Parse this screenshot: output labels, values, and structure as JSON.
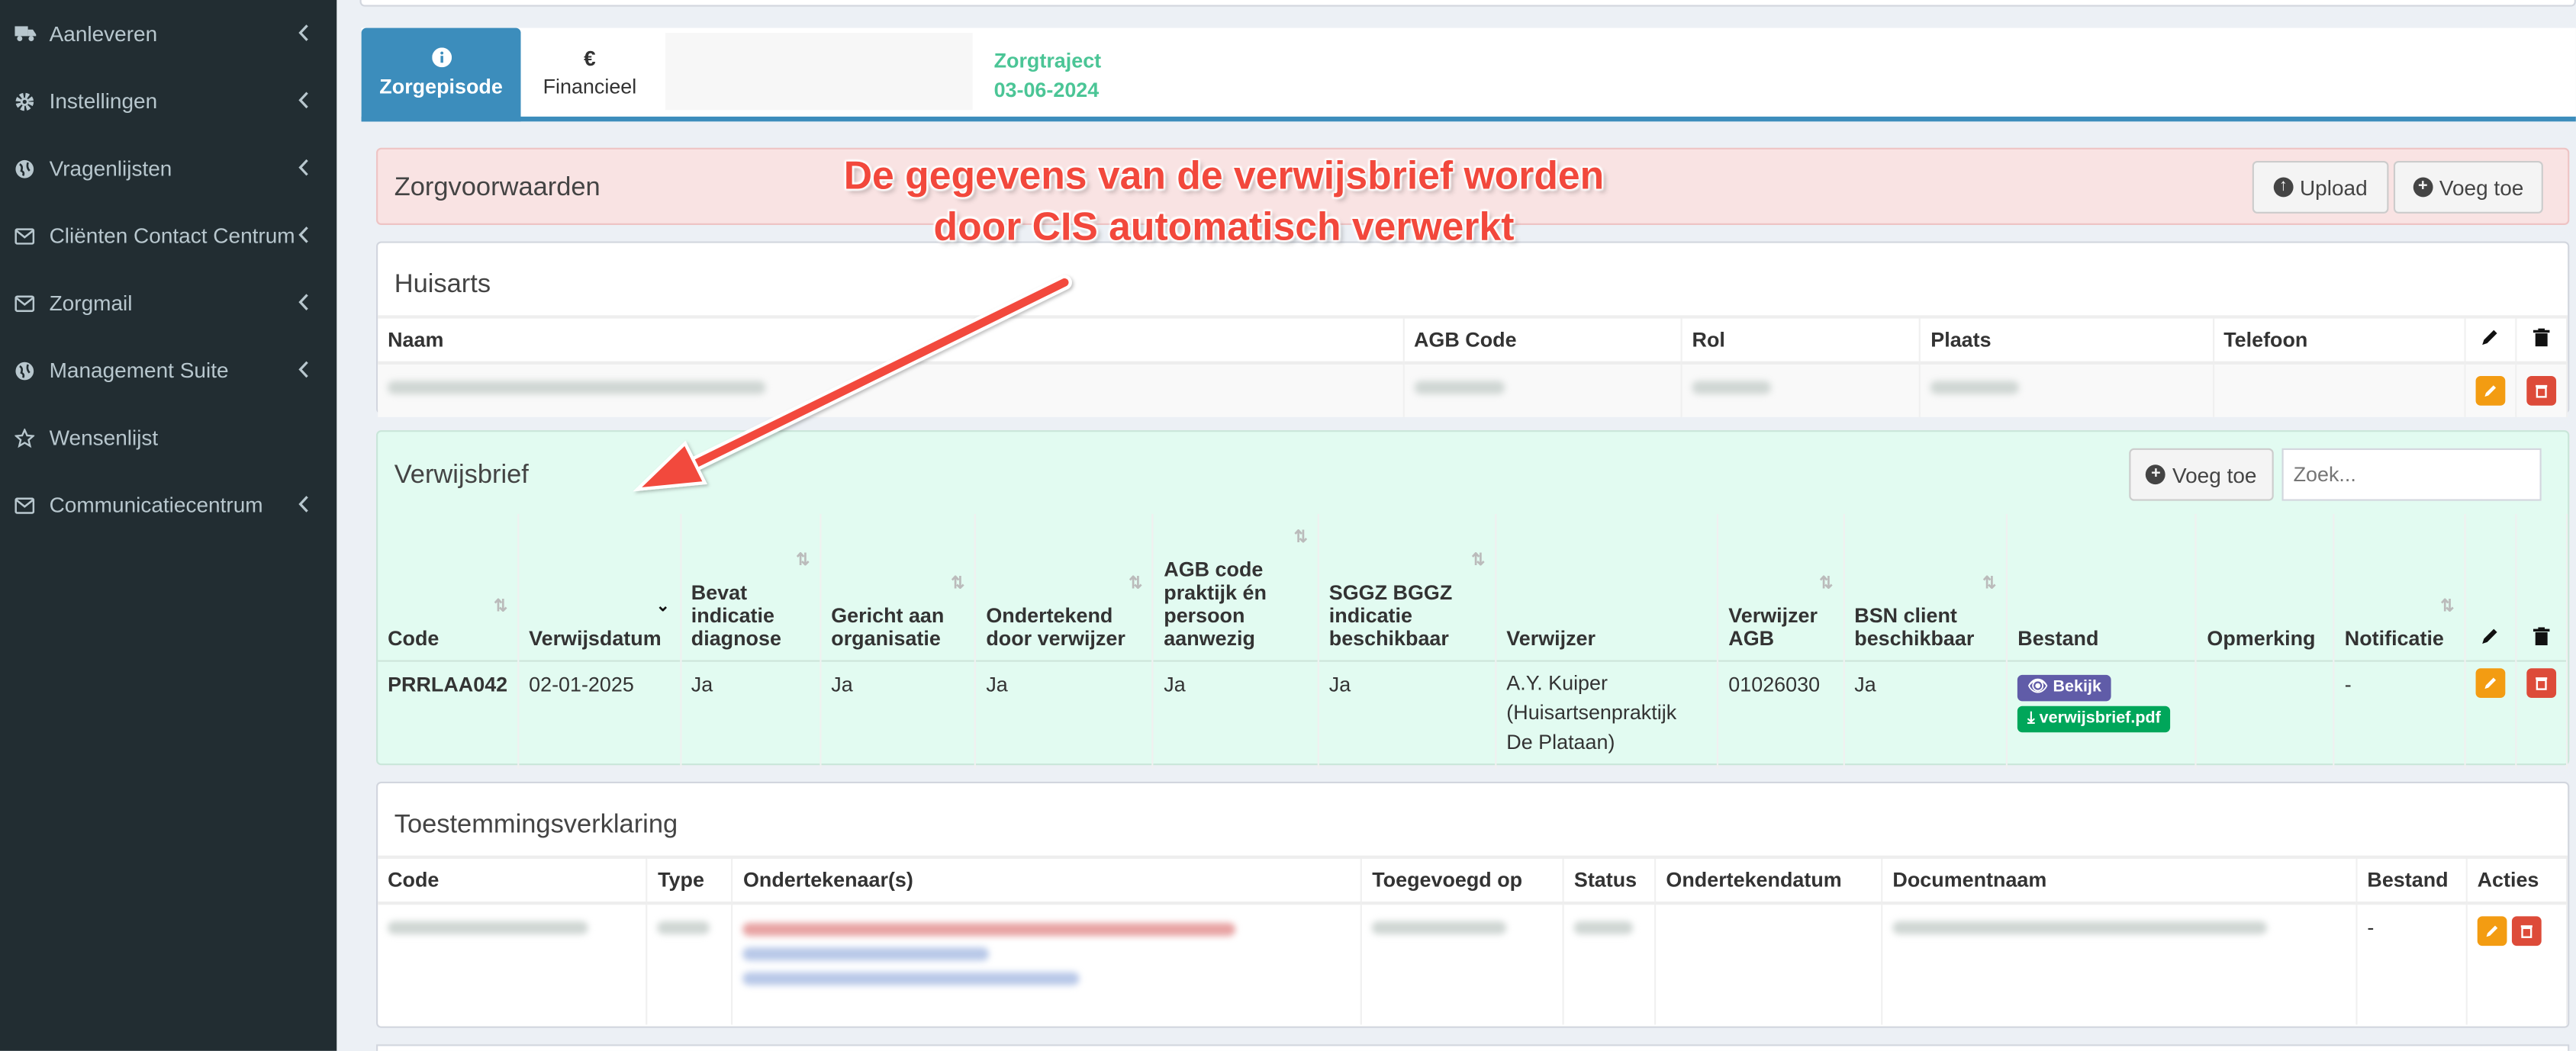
{
  "sidebar": {
    "items": [
      {
        "label": "Aanleveren",
        "icon": "truck-icon"
      },
      {
        "label": "Instellingen",
        "icon": "gear-icon"
      },
      {
        "label": "Vragenlijsten",
        "icon": "globe-icon"
      },
      {
        "label": "Cliënten Contact Centrum",
        "icon": "envelope-icon"
      },
      {
        "label": "Zorgmail",
        "icon": "envelope-icon"
      },
      {
        "label": "Management Suite",
        "icon": "globe-icon"
      },
      {
        "label": "Wensenlijst",
        "icon": "star-icon"
      },
      {
        "label": "Communicatiecentrum",
        "icon": "envelope-icon"
      }
    ]
  },
  "tabs": {
    "zorgepisode": {
      "label": "Zorgepisode",
      "icon": "info-icon",
      "glyph": "i"
    },
    "financieel": {
      "label": "Financieel",
      "icon": "euro-icon",
      "glyph": "€"
    },
    "zorgtraject": {
      "label": "Zorgtraject",
      "date": "03-06-2024"
    }
  },
  "annotation": {
    "line1": "De gegevens van de verwijsbrief worden",
    "line2": "door CIS automatisch verwerkt"
  },
  "zorgvoorwaarden": {
    "title": "Zorgvoorwaarden",
    "upload": "Upload",
    "add": "Voeg toe"
  },
  "huisarts": {
    "title": "Huisarts",
    "columns": [
      "Naam",
      "AGB Code",
      "Rol",
      "Plaats",
      "Telefoon"
    ]
  },
  "verwijsbrief": {
    "title": "Verwijsbrief",
    "add": "Voeg toe",
    "search_placeholder": "Zoek...",
    "columns": [
      "Code",
      "Verwijsdatum",
      "Bevat indicatie diagnose",
      "Gericht aan organisatie",
      "Ondertekend door verwijzer",
      "AGB code praktijk én persoon aanwezig",
      "SGGZ BGGZ indicatie beschikbaar",
      "Verwijzer",
      "Verwijzer AGB",
      "BSN client beschikbaar",
      "Bestand",
      "Opmerking",
      "Notificatie"
    ],
    "row": {
      "code": "PRRLAA042",
      "verwijsdatum": "02-01-2025",
      "bevat_indicatie": "Ja",
      "gericht_aan": "Ja",
      "ondertekend": "Ja",
      "agb_aanwezig": "Ja",
      "sggz_bggz": "Ja",
      "verwijzer": "A.Y. Kuiper (Huisartsenpraktijk De Plataan)",
      "verwijzer_agb": "01026030",
      "bsn": "Ja",
      "bekijk": "Bekijk",
      "bestand": "verwijsbrief.pdf",
      "opmerking": "",
      "notificatie": "-"
    },
    "colors": {
      "bekijk": "#605ca8",
      "download": "#00a65a",
      "background": "#e2fbf1"
    }
  },
  "toestemming": {
    "title": "Toestemmingsverklaring",
    "columns": [
      "Code",
      "Type",
      "Ondertekenaar(s)",
      "Toegevoegd op",
      "Status",
      "Ondertekendatum",
      "Documentnaam",
      "Bestand",
      "Acties"
    ],
    "row": {
      "bestand": "-"
    }
  },
  "colors": {
    "sidebar": "#222d32",
    "primary": "#3c8dbc",
    "warning": "#f39c12",
    "danger": "#dd4b39",
    "annotation": "#f2483c"
  }
}
